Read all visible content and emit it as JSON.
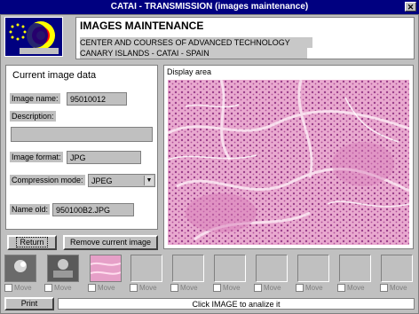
{
  "window": {
    "title": "CATAI - TRANSMISSION (images maintenance)",
    "close_glyph": "✕"
  },
  "header": {
    "title": "IMAGES MAINTENANCE",
    "line1": "CENTER AND COURSES OF ADVANCED TECHNOLOGY",
    "line2": "CANARY ISLANDS - CATAI - SPAIN"
  },
  "current": {
    "heading": "Current image data",
    "image_name_label": "Image name:",
    "image_name_value": "95010012",
    "description_label": "Description:",
    "description_value": "",
    "format_label": "Image format:",
    "format_value": "JPG",
    "compression_label": "Compression mode:",
    "compression_value": "JPEG",
    "name_old_label": "Name old:",
    "name_old_value": "950100B2.JPG"
  },
  "display": {
    "label": "Display area"
  },
  "buttons": {
    "return": "Return",
    "remove": "Remove current image",
    "print": "Print"
  },
  "thumbnails": [
    {
      "filled": true,
      "kind": "dark1"
    },
    {
      "filled": true,
      "kind": "dark2"
    },
    {
      "filled": true,
      "kind": "pink"
    },
    {
      "filled": false
    },
    {
      "filled": false
    },
    {
      "filled": false
    },
    {
      "filled": false
    },
    {
      "filled": false
    },
    {
      "filled": false
    },
    {
      "filled": false
    }
  ],
  "move_label": "Move",
  "status": "Click IMAGE to analize it",
  "colors": {
    "titlebar": "#000080",
    "tissue": "#e8a8c8"
  }
}
